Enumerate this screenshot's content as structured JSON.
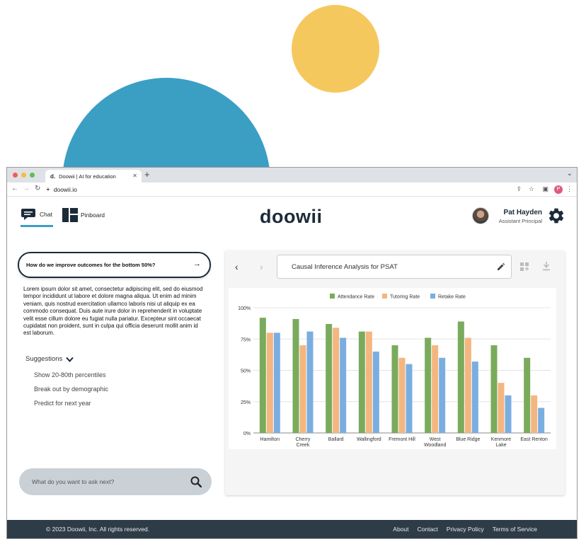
{
  "browser": {
    "tab_title": "Doowii | AI for education",
    "tab_favicon": "d.",
    "url": "doowii.io",
    "profile_initial": "P"
  },
  "nav": {
    "chat_label": "Chat",
    "pinboard_label": "Pinboard"
  },
  "header": {
    "logo": "doowii",
    "user_name": "Pat Hayden",
    "user_role": "Assistant Principal"
  },
  "chat": {
    "question": "How do we improve outcomes for the bottom 50%?",
    "answer": "Lorem ipsum dolor sit amet, consectetur adipiscing elit, sed do eiusmod tempor incididunt ut labore et dolore magna aliqua. Ut enim ad minim veniam, quis nostrud exercitation ullamco laboris nisi ut aliquip ex ea commodo consequat. Duis aute irure dolor in reprehenderit in voluptate velit esse cillum dolore eu fugiat nulla pariatur. Excepteur sint occaecat cupidatat non proident, sunt in culpa qui officia deserunt mollit anim id est laborum.",
    "suggestions_label": "Suggestions",
    "suggestions": [
      "Show 20-80th percentiles",
      "Break out by demographic",
      "Predict for next year"
    ],
    "ask_placeholder": "What do you want to ask next?"
  },
  "panel": {
    "title": "Causal Inference Analysis for PSAT"
  },
  "chart_data": {
    "type": "bar",
    "categories": [
      [
        "Hamilton"
      ],
      [
        "Cherry",
        "Creek"
      ],
      [
        "Ballard"
      ],
      [
        "Wallingford"
      ],
      [
        "Fremont Hill"
      ],
      [
        "West",
        "Woodland"
      ],
      [
        "Blue Ridge"
      ],
      [
        "Kenmore",
        "Lake"
      ],
      [
        "East Renton"
      ]
    ],
    "series": [
      {
        "name": "Attendance Rate",
        "color": "#7aab5c",
        "values": [
          92,
          91,
          87,
          81,
          70,
          76,
          89,
          70,
          60
        ]
      },
      {
        "name": "Tutoring Rate",
        "color": "#f4b67f",
        "values": [
          80,
          70,
          84,
          81,
          60,
          70,
          76,
          40,
          30
        ]
      },
      {
        "name": "Retake Rate",
        "color": "#7aaee0",
        "values": [
          80,
          81,
          76,
          65,
          55,
          60,
          57,
          30,
          20
        ]
      }
    ],
    "ylim": [
      0,
      100
    ],
    "yticks": [
      "0%",
      "25%",
      "50%",
      "75%",
      "100%"
    ],
    "grid": true,
    "legend_position": "top-center"
  },
  "footer": {
    "copyright": "© 2023 Doowii, Inc. All rights reserved.",
    "links": [
      "About",
      "Contact",
      "Privacy Policy",
      "Terms of Service"
    ]
  }
}
